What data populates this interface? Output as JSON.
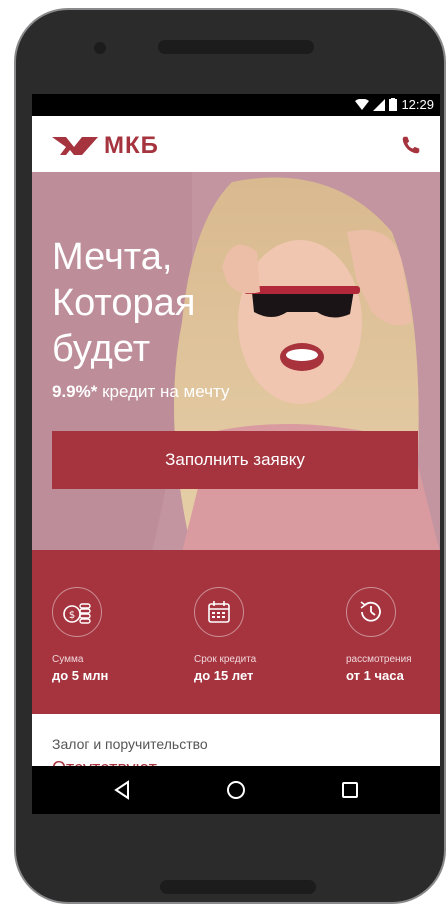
{
  "status_bar": {
    "time": "12:29"
  },
  "header": {
    "logo_text": "МКБ"
  },
  "hero": {
    "title_lines": [
      "Мечта,",
      "Которая",
      "будет"
    ],
    "rate": "9.9%*",
    "subtitle": " кредит на мечту",
    "apply_button": "Заполнить заявку"
  },
  "features": [
    {
      "icon": "coins-icon",
      "label": "Сумма",
      "value": "до 5 млн"
    },
    {
      "icon": "calendar-icon",
      "label": "Срок кредита",
      "value": "до 15 лет"
    },
    {
      "icon": "clock-history-icon",
      "label": "рассмотрения",
      "value": "от 1 часа"
    }
  ],
  "collateral": {
    "label": "Залог и поручительство",
    "value": "Отсутствуют"
  },
  "colors": {
    "brand": "#a5343f",
    "hero_bg": "#c296a1"
  }
}
